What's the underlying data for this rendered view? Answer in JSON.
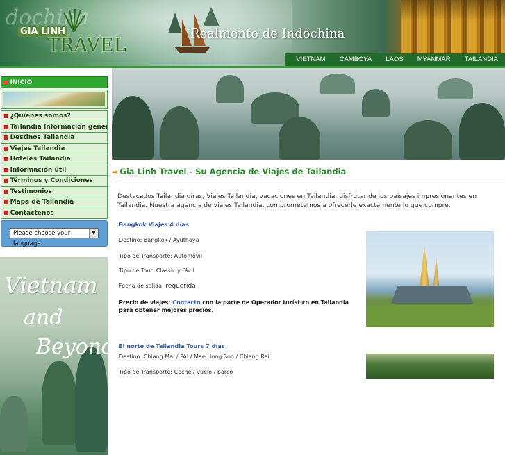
{
  "header": {
    "logo_ghost": "dochina",
    "logo_top": "GIA LINH",
    "logo_bottom": "TRAVEL",
    "tagline": "Realmente de Indochina",
    "nav": [
      "VIETNAM",
      "CAMBOYA",
      "LAOS",
      "MYANMAR",
      "TAILANDIA"
    ]
  },
  "sidebar": {
    "home": "INICIO",
    "items": [
      "¿Quienes somos?",
      "Tailandia Información general",
      "Destinos Tailandia",
      "Viajes Tailandia",
      "Hoteles Tailandia",
      "Información útil",
      "Términos y Condiciones",
      "Testimonios",
      "Mapa de Tailandia",
      "Contáctenos"
    ],
    "language_select": "Please choose your language",
    "banner": {
      "line1": "Vietnam",
      "line2": "and",
      "line3": "Beyond"
    }
  },
  "main": {
    "section_title": "Gia Linh Travel - Su Agencia de Viajes de Tailandia",
    "intro": "Destacados Tailandia giras, Viajes Tailandia, vacaciones en Tailandia, disfrutar de los paisajes impresionantes en Tailandia. Nuestra agencia de viajes Tailandia, comprometemos a ofrecerle exactamente lo que compre.",
    "tours": [
      {
        "title": "Bangkok Viajes 4 días",
        "destino": "Destino: Bangkok / Ayuthaya",
        "transporte": "Tipo de Transporte: Automóvil",
        "tipo": "Tipo de Tour: Classic y Fácil",
        "fecha_label": "Fecha de salida: ",
        "fecha_value": "requerida",
        "price_prefix": "Precio de viajes: ",
        "price_link": "Contacto",
        "price_suffix": " con la parte de Operador turístico en Tailandia para obtener mejores precios."
      },
      {
        "title": "El norte de Tailandia Tours 7 días",
        "destino": "Destino: Chiang Mai / PAI / Mae Hong Son / Chiang Rai",
        "transporte": "Tipo de Transporte: Coche / vuelo / barco"
      }
    ]
  },
  "colors": {
    "nav_bar": "#226b2a",
    "menu_border": "#4aa04a",
    "menu_bg": "#dff2d8",
    "title_green": "#2e8a2e",
    "link_blue": "#3a5fb0"
  }
}
